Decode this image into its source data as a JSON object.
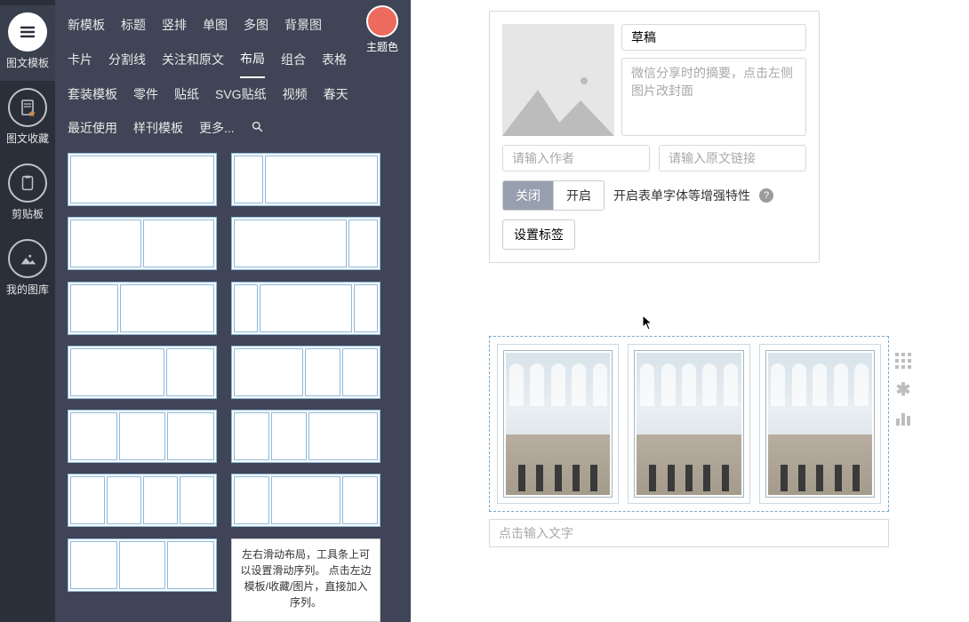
{
  "rail": {
    "items": [
      {
        "label": "图文模板",
        "icon": "menu-icon"
      },
      {
        "label": "图文收藏",
        "icon": "page-star-icon"
      },
      {
        "label": "剪贴板",
        "icon": "clipboard-icon"
      },
      {
        "label": "我的图库",
        "icon": "gallery-icon"
      }
    ],
    "active": 0
  },
  "tabs": {
    "rows": [
      [
        "新模板",
        "标题",
        "竖排",
        "单图",
        "多图",
        "背景图",
        "卡片"
      ],
      [
        "分割线",
        "关注和原文",
        "布局",
        "组合",
        "表格",
        "套装模板"
      ],
      [
        "零件",
        "贴纸",
        "SVG贴纸",
        "视频",
        "春天",
        "最近使用"
      ],
      [
        "样刊模板",
        "更多..."
      ]
    ],
    "active": "布局",
    "searchTitle": "搜索"
  },
  "theme": {
    "label": "主题色",
    "color": "#ec6a5e"
  },
  "layouts": {
    "tooltip": "左右滑动布局，工具条上可以设置滑动序列。\n点击左边模板/收藏/图片，直接加入序列。"
  },
  "meta": {
    "title": "草稿",
    "summaryPlaceholder": "微信分享时的摘要，点击左侧图片改封面",
    "authorPlaceholder": "请输入作者",
    "sourcePlaceholder": "请输入原文链接",
    "toggle": {
      "off": "关闭",
      "on": "开启",
      "active": "off"
    },
    "enhanceLabel": "开启表单字体等增强特性",
    "tagsButton": "设置标签"
  },
  "content": {
    "captionPlaceholder": "点击输入文字"
  },
  "sideTools": {
    "grid": "grid-icon",
    "star": "asterisk-icon",
    "chart": "bars-icon"
  }
}
